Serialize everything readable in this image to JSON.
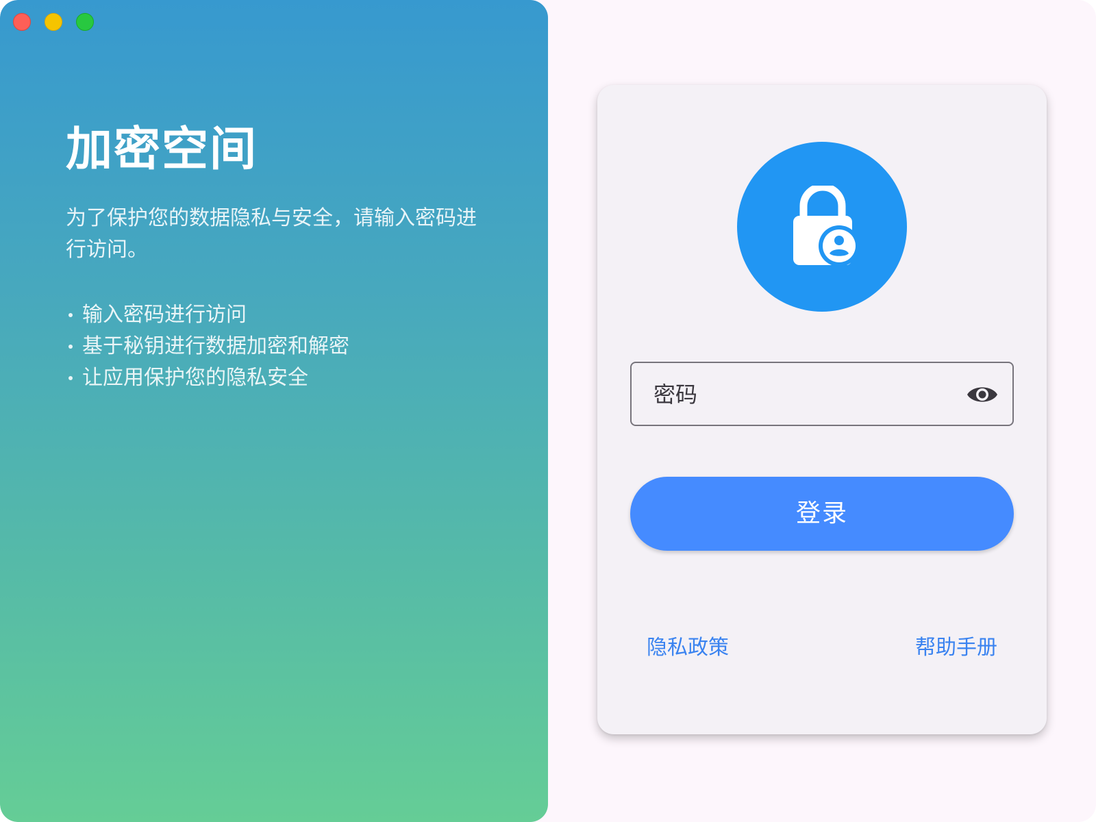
{
  "window": {
    "controls": [
      "close",
      "minimize",
      "maximize"
    ]
  },
  "left_panel": {
    "title": "加密空间",
    "description": "为了保护您的数据隐私与安全，请输入密码进行访问。",
    "bullets": [
      "输入密码进行访问",
      "基于秘钥进行数据加密和解密",
      "让应用保护您的隐私安全"
    ],
    "gradient_colors": [
      "#3799cf",
      "#65cd96"
    ]
  },
  "login_card": {
    "icon": "lock-person-icon",
    "icon_circle_color": "#2196f3",
    "password_field": {
      "label": "密码",
      "toggle_icon": "eye-icon"
    },
    "login_button_label": "登录",
    "login_button_color": "#458bff",
    "links": {
      "privacy": "隐私政策",
      "help": "帮助手册"
    },
    "link_color": "#3a83f0"
  }
}
